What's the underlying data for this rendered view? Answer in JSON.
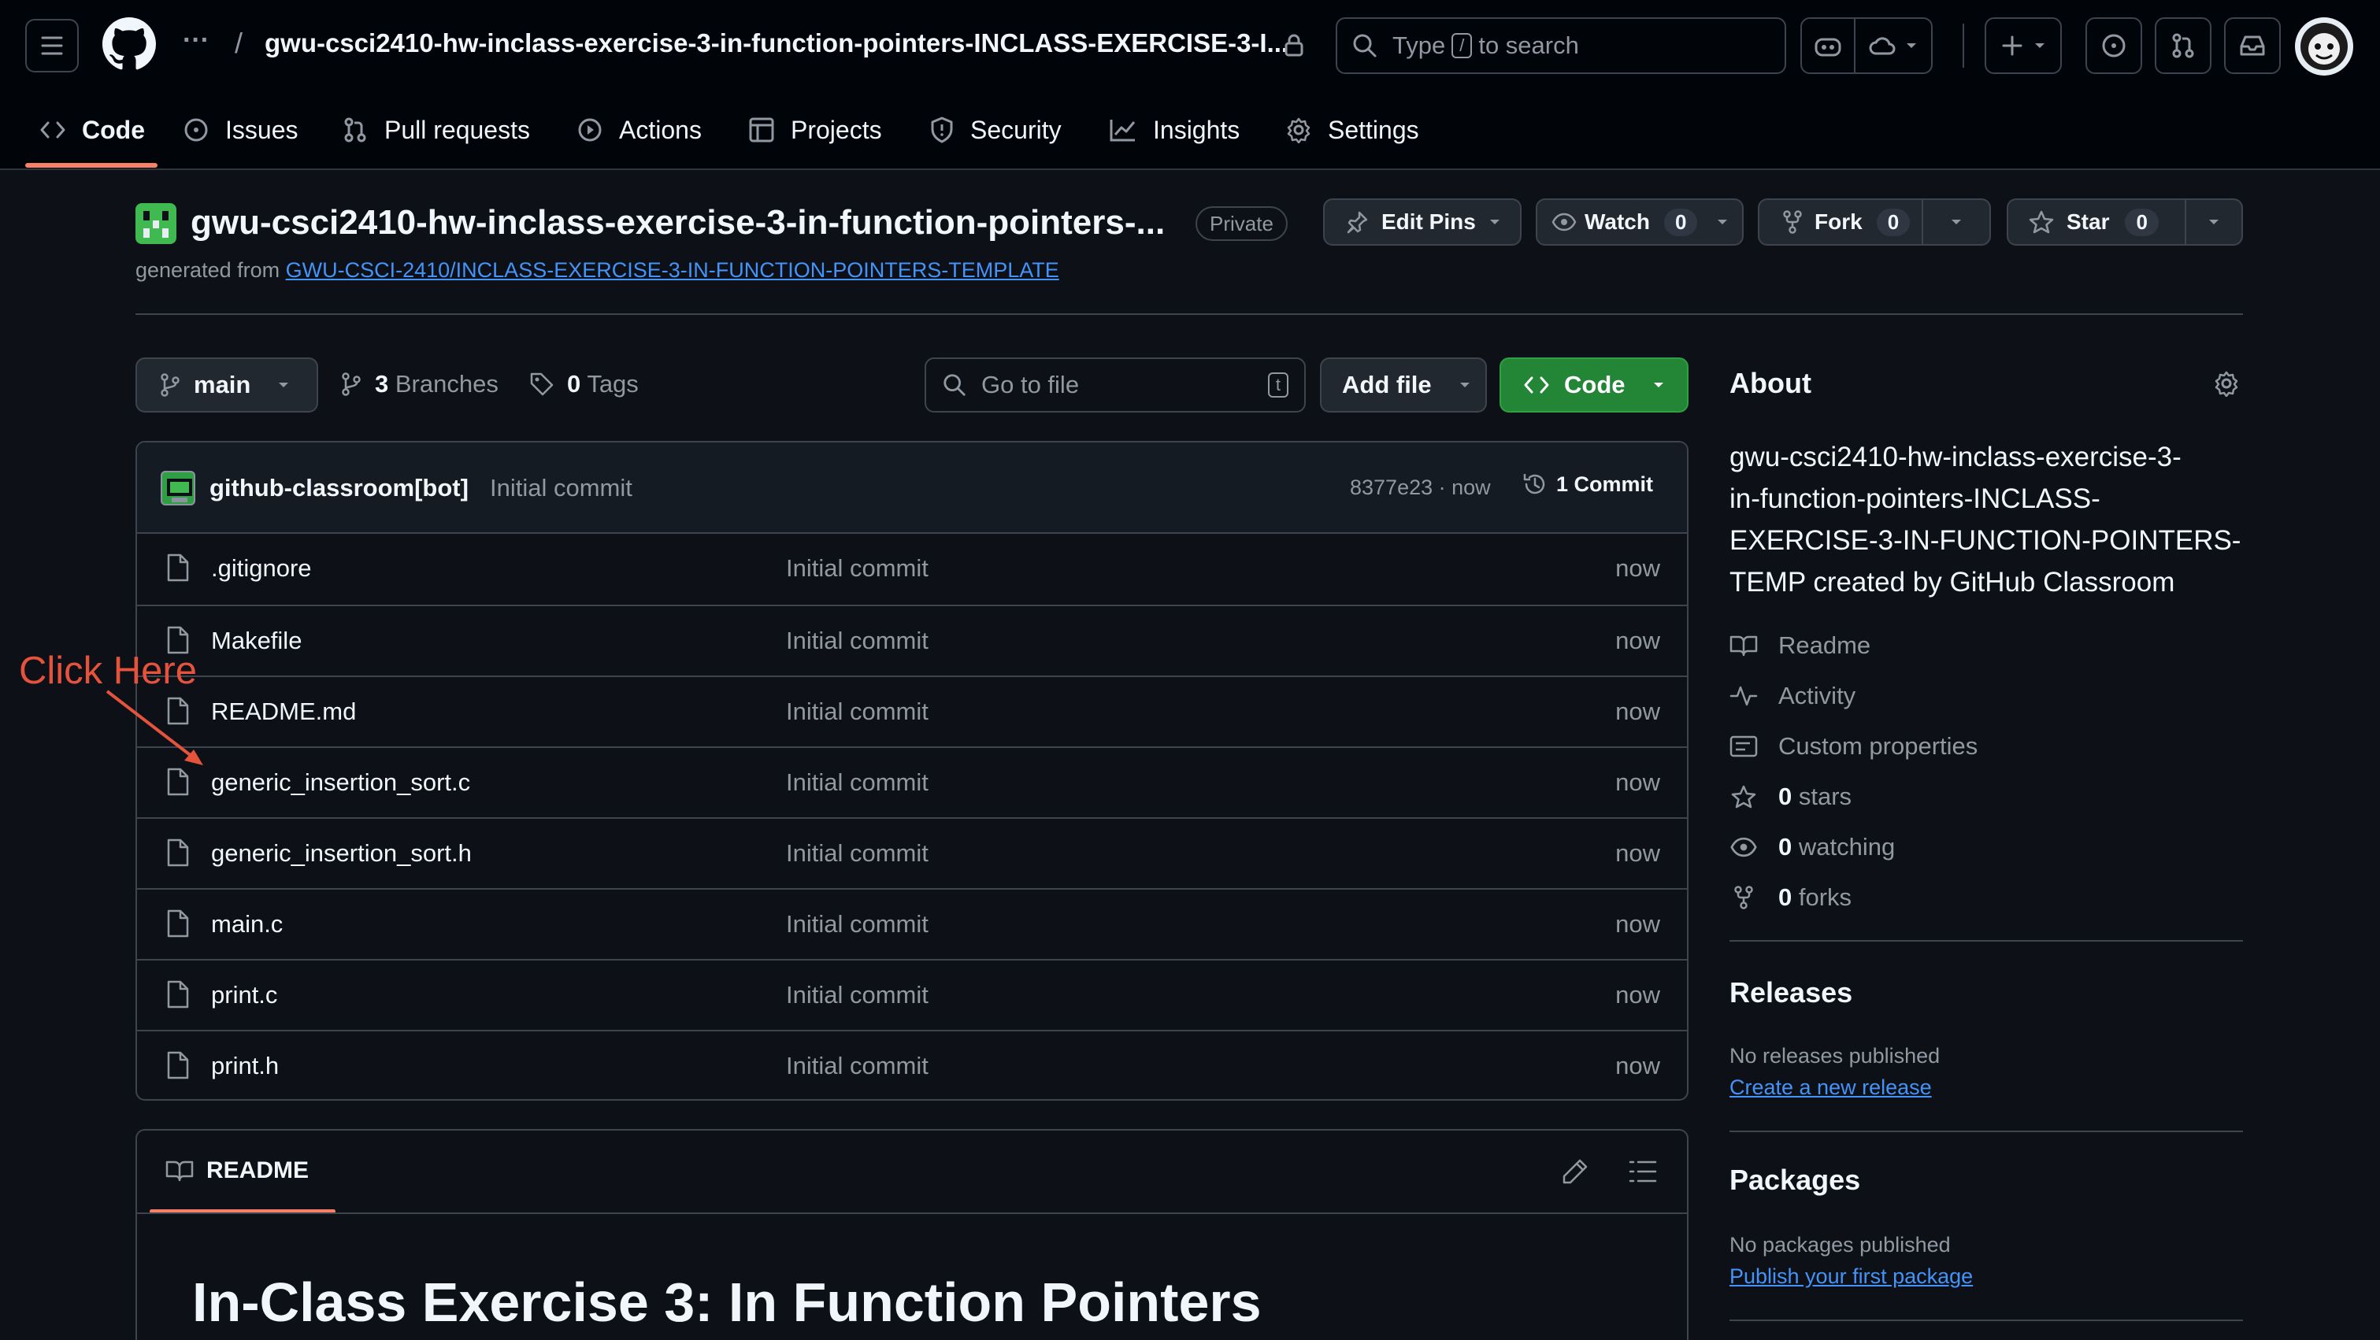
{
  "header": {
    "repo_path": "gwu-csci2410-hw-inclass-exercise-3-in-function-pointers-INCLASS-EXERCISE-3-I...",
    "separator": "/",
    "ellipsis": "···",
    "search_prefix": "Type",
    "search_key": "/",
    "search_suffix": "to search"
  },
  "nav_tabs": [
    {
      "label": "Code",
      "active": true
    },
    {
      "label": "Issues"
    },
    {
      "label": "Pull requests"
    },
    {
      "label": "Actions"
    },
    {
      "label": "Projects"
    },
    {
      "label": "Security"
    },
    {
      "label": "Insights"
    },
    {
      "label": "Settings"
    }
  ],
  "repo": {
    "title": "gwu-csci2410-hw-inclass-exercise-3-in-function-pointers-...",
    "visibility": "Private",
    "generated_from_label": "generated from",
    "generated_from_link": "GWU-CSCI-2410/INCLASS-EXERCISE-3-IN-FUNCTION-POINTERS-TEMPLATE",
    "edit_pins": "Edit Pins",
    "watch": {
      "label": "Watch",
      "count": "0"
    },
    "fork": {
      "label": "Fork",
      "count": "0"
    },
    "star": {
      "label": "Star",
      "count": "0"
    }
  },
  "toolbar": {
    "branch": "main",
    "branches_count": "3",
    "branches_label": "Branches",
    "tags_count": "0",
    "tags_label": "Tags",
    "goto_placeholder": "Go to file",
    "goto_key": "t",
    "add_file": "Add file",
    "code": "Code"
  },
  "commit": {
    "author": "github-classroom[bot]",
    "message": "Initial commit",
    "hash_time": "8377e23 · now",
    "commits_label": "1 Commit"
  },
  "files": [
    {
      "name": ".gitignore",
      "message": "Initial commit",
      "time": "now"
    },
    {
      "name": "Makefile",
      "message": "Initial commit",
      "time": "now"
    },
    {
      "name": "README.md",
      "message": "Initial commit",
      "time": "now"
    },
    {
      "name": "generic_insertion_sort.c",
      "message": "Initial commit",
      "time": "now"
    },
    {
      "name": "generic_insertion_sort.h",
      "message": "Initial commit",
      "time": "now"
    },
    {
      "name": "main.c",
      "message": "Initial commit",
      "time": "now"
    },
    {
      "name": "print.c",
      "message": "Initial commit",
      "time": "now"
    },
    {
      "name": "print.h",
      "message": "Initial commit",
      "time": "now"
    }
  ],
  "annotation": {
    "text": "Click Here",
    "color": "#e5533d"
  },
  "readme": {
    "tab": "README",
    "heading": "In-Class Exercise 3: In Function Pointers"
  },
  "about": {
    "title": "About",
    "description_lines": [
      "gwu-csci2410-hw-inclass-exercise-3-",
      "in-function-pointers-INCLASS-",
      "EXERCISE-3-IN-FUNCTION-POINTERS-",
      "TEMP created by GitHub Classroom"
    ],
    "readme": "Readme",
    "activity": "Activity",
    "custom_properties": "Custom properties",
    "stars_count": "0",
    "stars_label": "stars",
    "watching_count": "0",
    "watching_label": "watching",
    "forks_count": "0",
    "forks_label": "forks"
  },
  "releases": {
    "title": "Releases",
    "empty": "No releases published",
    "create_link": "Create a new release"
  },
  "packages": {
    "title": "Packages",
    "empty": "No packages published",
    "publish_link": "Publish your first package"
  },
  "colors": {
    "background": "#0d1117",
    "header_bg": "#010409",
    "accent_green": "#238636",
    "link_blue": "#4493f8",
    "active_tab_underline": "#f78166"
  }
}
